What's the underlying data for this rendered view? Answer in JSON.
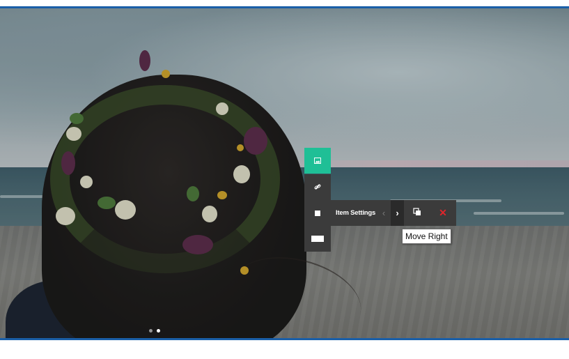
{
  "toolbar": {
    "settings_label": "Item Settings",
    "nav_left_glyph": "‹",
    "nav_right_glyph": "›",
    "delete_glyph": "✕",
    "icons": [
      "image-icon",
      "link-icon",
      "square-icon",
      "rectangle-icon",
      "chevron-left-icon",
      "chevron-right-icon",
      "duplicate-icon",
      "close-icon"
    ]
  },
  "tooltip": {
    "text": "Move Right"
  },
  "slider": {
    "dots_count": 2,
    "active_dot": 2
  },
  "colors": {
    "accent": "#1fbf96",
    "toolbar_bg": "#3b3b3b",
    "delete": "#e0252b",
    "frame_border": "#1a5fa8"
  }
}
